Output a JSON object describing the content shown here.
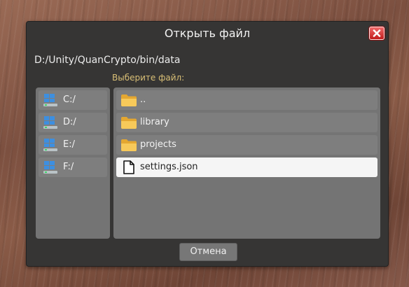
{
  "dialog": {
    "title": "Открыть файл",
    "close_icon": "close-icon",
    "path": "D:/Unity/QuanCrypto/bin/data",
    "select_label": "Выберите файл:",
    "cancel_label": "Отмена"
  },
  "drives": [
    {
      "label": "C:/",
      "icon": "drive-icon"
    },
    {
      "label": "D:/",
      "icon": "drive-icon"
    },
    {
      "label": "E:/",
      "icon": "drive-icon"
    },
    {
      "label": "F:/",
      "icon": "drive-icon"
    }
  ],
  "files": [
    {
      "label": "..",
      "icon": "folder-icon",
      "selected": false
    },
    {
      "label": "library",
      "icon": "folder-icon",
      "selected": false
    },
    {
      "label": "projects",
      "icon": "folder-icon",
      "selected": false
    },
    {
      "label": "settings.json",
      "icon": "file-icon",
      "selected": true
    }
  ],
  "colors": {
    "dialog_background": "#363534",
    "panel_background": "#747474",
    "item_background": "#7e7e7e",
    "selected_background": "#f5f5f5",
    "label_accent": "#d9bf76",
    "close_button": "#d62b2b"
  }
}
